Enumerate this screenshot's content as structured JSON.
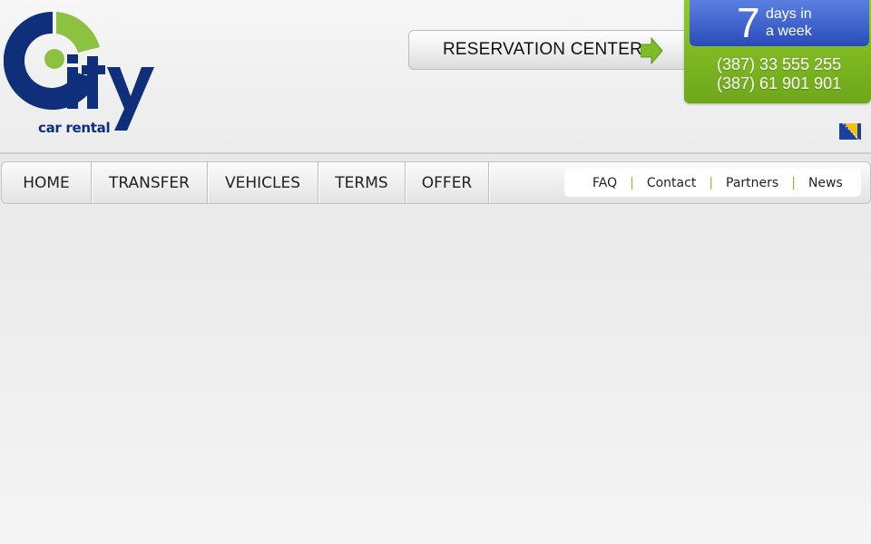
{
  "logo": {
    "subtitle": "car rental"
  },
  "reservation": {
    "label": "RESERVATION CENTER"
  },
  "promo": {
    "number": "7",
    "days_line1": "days in",
    "days_line2": "a week",
    "phone1": "(387) 33 555 255",
    "phone2": "(387) 61 901 901"
  },
  "language": {
    "icon": "bosnia-flag-icon"
  },
  "nav": {
    "items": [
      "HOME",
      "TRANSFER",
      "VEHICLES",
      "TERMS",
      "OFFER"
    ],
    "sub": [
      "FAQ",
      "Contact",
      "Partners",
      "News"
    ],
    "separator": "|"
  },
  "colors": {
    "brand_blue": "#0f2f7a",
    "brand_green": "#8cc23f",
    "promo_green": "#7ab61f",
    "promo_blue": "#3b5fd0"
  }
}
